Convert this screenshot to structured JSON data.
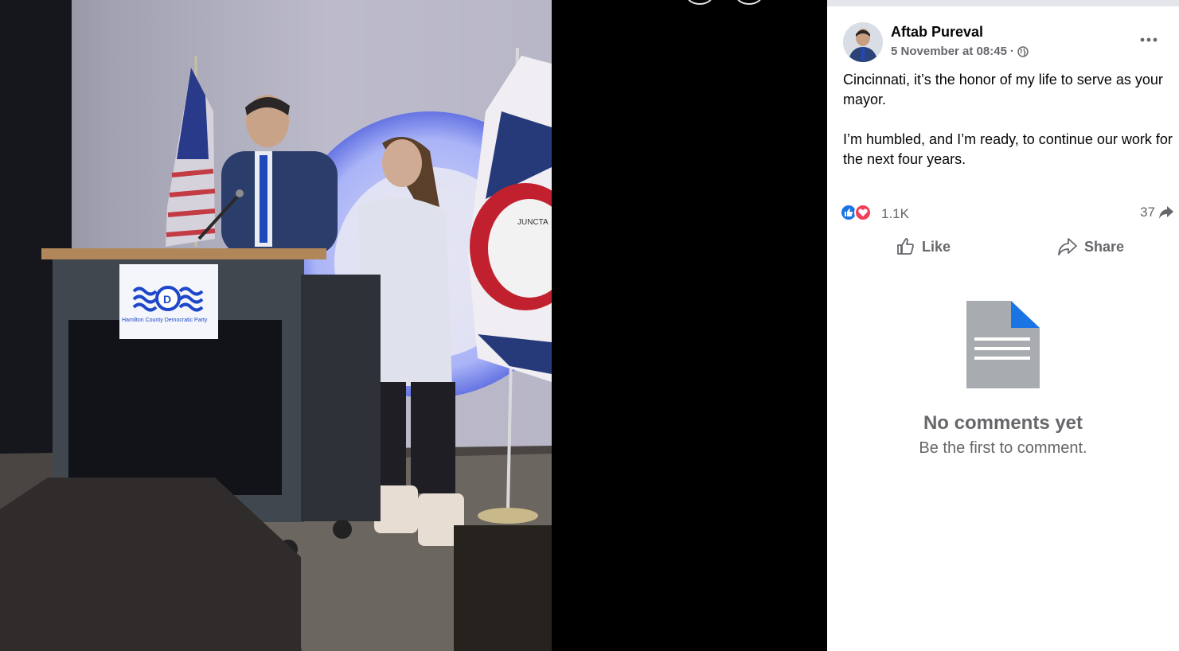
{
  "post": {
    "author": "Aftab Pureval",
    "timestamp": "5 November at 08:45",
    "separator": "·",
    "privacy_icon": "globe-icon",
    "paragraphs": [
      "Cincinnati, it’s the honor of my life to serve as your mayor.",
      "I’m humbled, and I’m ready, to continue our work for the next four years."
    ]
  },
  "reactions": {
    "icons": [
      "like-reaction-icon",
      "love-reaction-icon"
    ],
    "count": "1.1K",
    "shares": "37"
  },
  "actions": {
    "like_label": "Like",
    "share_label": "Share"
  },
  "comments": {
    "empty_title": "No comments yet",
    "empty_subtitle": "Be the first to comment."
  },
  "colors": {
    "accent_blue": "#1b74e4",
    "love_red": "#f33e58",
    "secondary_text": "#65676b"
  },
  "photo": {
    "podium_sign_text": "Hamilton County Democratic Party",
    "flag_text": "JUNCTA"
  }
}
